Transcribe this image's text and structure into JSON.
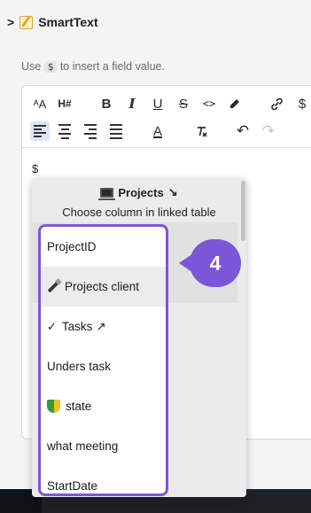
{
  "header": {
    "arrow": ">",
    "title": "SmartText",
    "icon": "memo-icon"
  },
  "hint": {
    "prefix": "Use",
    "code": "$",
    "suffix": "to insert a field value."
  },
  "toolbar": {
    "row1": [
      "A/A",
      "H#",
      "B",
      "I",
      "U",
      "S",
      "<>",
      "highlight",
      "link",
      "$"
    ],
    "row2": [
      "align-left",
      "align-center",
      "align-right",
      "align-justify",
      "font-color",
      "clear-format",
      "undo",
      "redo"
    ],
    "glyphs": {
      "font_size": "ᴬA",
      "heading": "H#",
      "bold": "B",
      "italic": "I",
      "underline": "U",
      "strike": "S",
      "code": "<>",
      "dollar": "$",
      "font_color": "A",
      "undo": "↶",
      "redo": "↷"
    }
  },
  "editor": {
    "content": "$"
  },
  "popup": {
    "title": "Projects",
    "title_icon": "laptop-icon",
    "title_arrow": "↘",
    "subtitle": "Choose column in linked table",
    "items": [
      {
        "label": "ProjectID",
        "icon": ""
      },
      {
        "label": "Projects client",
        "icon": "paintbrush-icon"
      },
      {
        "label": "Tasks",
        "icon": "check-icon",
        "suffix": "↗"
      },
      {
        "label": "Unders task",
        "icon": ""
      },
      {
        "label": "state",
        "icon": "beginner-shield-icon"
      },
      {
        "label": "what meeting",
        "icon": ""
      },
      {
        "label": "StartDate",
        "icon": ""
      }
    ]
  },
  "step_badge": {
    "number": "4"
  },
  "colors": {
    "accent": "#7b57d8",
    "active_tool": "#dbe6fb"
  }
}
